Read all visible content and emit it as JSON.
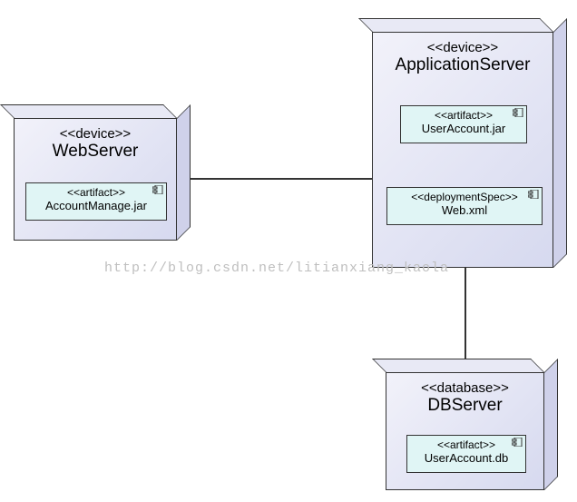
{
  "nodes": {
    "web": {
      "stereotype": "<<device>>",
      "name": "WebServer",
      "artifact": {
        "stereotype": "<<artifact>>",
        "name": "AccountManage.jar"
      }
    },
    "app": {
      "stereotype": "<<device>>",
      "name": "ApplicationServer",
      "artifact": {
        "stereotype": "<<artifact>>",
        "name": "UserAccount.jar"
      },
      "spec": {
        "stereotype": "<<deploymentSpec>>",
        "name": "Web.xml"
      }
    },
    "db": {
      "stereotype": "<<database>>",
      "name": "DBServer",
      "artifact": {
        "stereotype": "<<artifact>>",
        "name": "UserAccount.db"
      }
    }
  },
  "watermark": "http://blog.csdn.net/litianxiang_kaola",
  "chart_data": {
    "type": "diagram",
    "diagram_type": "UML Deployment Diagram",
    "nodes": [
      {
        "id": "WebServer",
        "stereotype": "device",
        "contains": [
          {
            "name": "AccountManage.jar",
            "stereotype": "artifact"
          }
        ]
      },
      {
        "id": "ApplicationServer",
        "stereotype": "device",
        "contains": [
          {
            "name": "UserAccount.jar",
            "stereotype": "artifact"
          },
          {
            "name": "Web.xml",
            "stereotype": "deploymentSpec"
          }
        ]
      },
      {
        "id": "DBServer",
        "stereotype": "database",
        "contains": [
          {
            "name": "UserAccount.db",
            "stereotype": "artifact"
          }
        ]
      }
    ],
    "edges": [
      {
        "from": "WebServer",
        "to": "ApplicationServer",
        "type": "association"
      },
      {
        "from": "ApplicationServer",
        "to": "DBServer",
        "type": "association"
      }
    ]
  }
}
